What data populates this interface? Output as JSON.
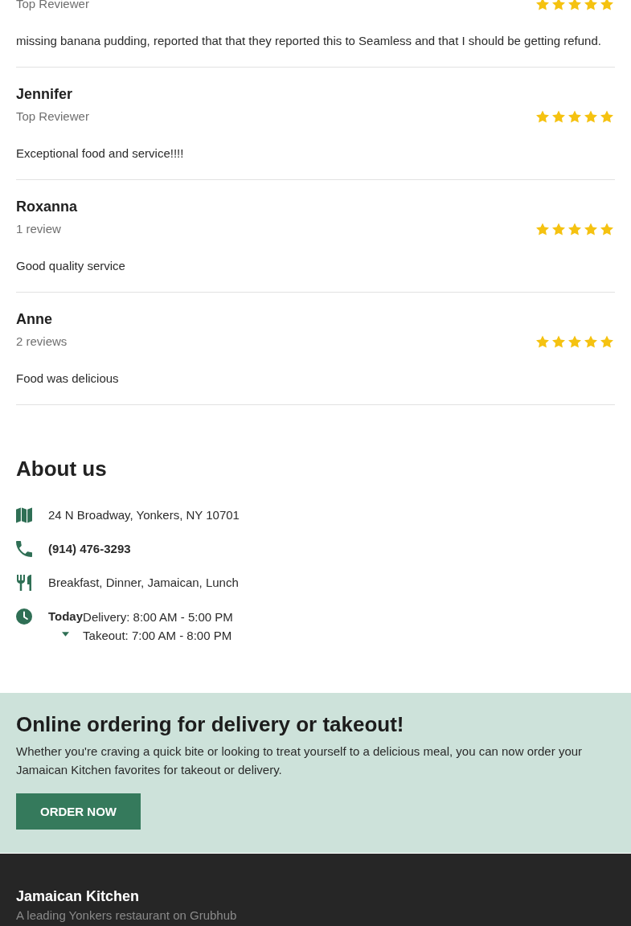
{
  "reviews": [
    {
      "reviewer_label": "Top Reviewer",
      "stars": 5,
      "text": "missing banana pudding, reported that that they reported this to Seamless and that I should be getting refund."
    },
    {
      "name": "Jennifer",
      "reviewer_label": "Top Reviewer",
      "stars": 5,
      "text": "Exceptional food and service!!!!"
    },
    {
      "name": "Roxanna",
      "reviewer_label": "1 review",
      "stars": 5,
      "text": "Good quality service"
    },
    {
      "name": "Anne",
      "reviewer_label": "2 reviews",
      "stars": 5,
      "text": "Food was delicious"
    }
  ],
  "about": {
    "title": "About us",
    "details": [
      {
        "kind": "address",
        "text": "24 N Broadway, Yonkers, NY 10701"
      },
      {
        "kind": "phone",
        "text": "(914) 476-3293"
      },
      {
        "kind": "cuisine",
        "text": "Breakfast, Dinner, Jamaican, Lunch"
      },
      {
        "kind": "hours",
        "day": "Today",
        "lines": [
          "Delivery: 8:00 AM - 5:00 PM",
          "Takeout: 7:00 AM - 8:00 PM"
        ]
      }
    ]
  },
  "order_banner": {
    "title": "Online ordering for delivery or takeout!",
    "text": "Whether you're craving a quick bite or looking to treat yourself to a delicious meal, you can now order your Jamaican Kitchen favorites for takeout or delivery.",
    "button": "ORDER NOW"
  },
  "footer": {
    "title": "Jamaican Kitchen",
    "subtitle": "A leading Yonkers restaurant on Grubhub"
  }
}
